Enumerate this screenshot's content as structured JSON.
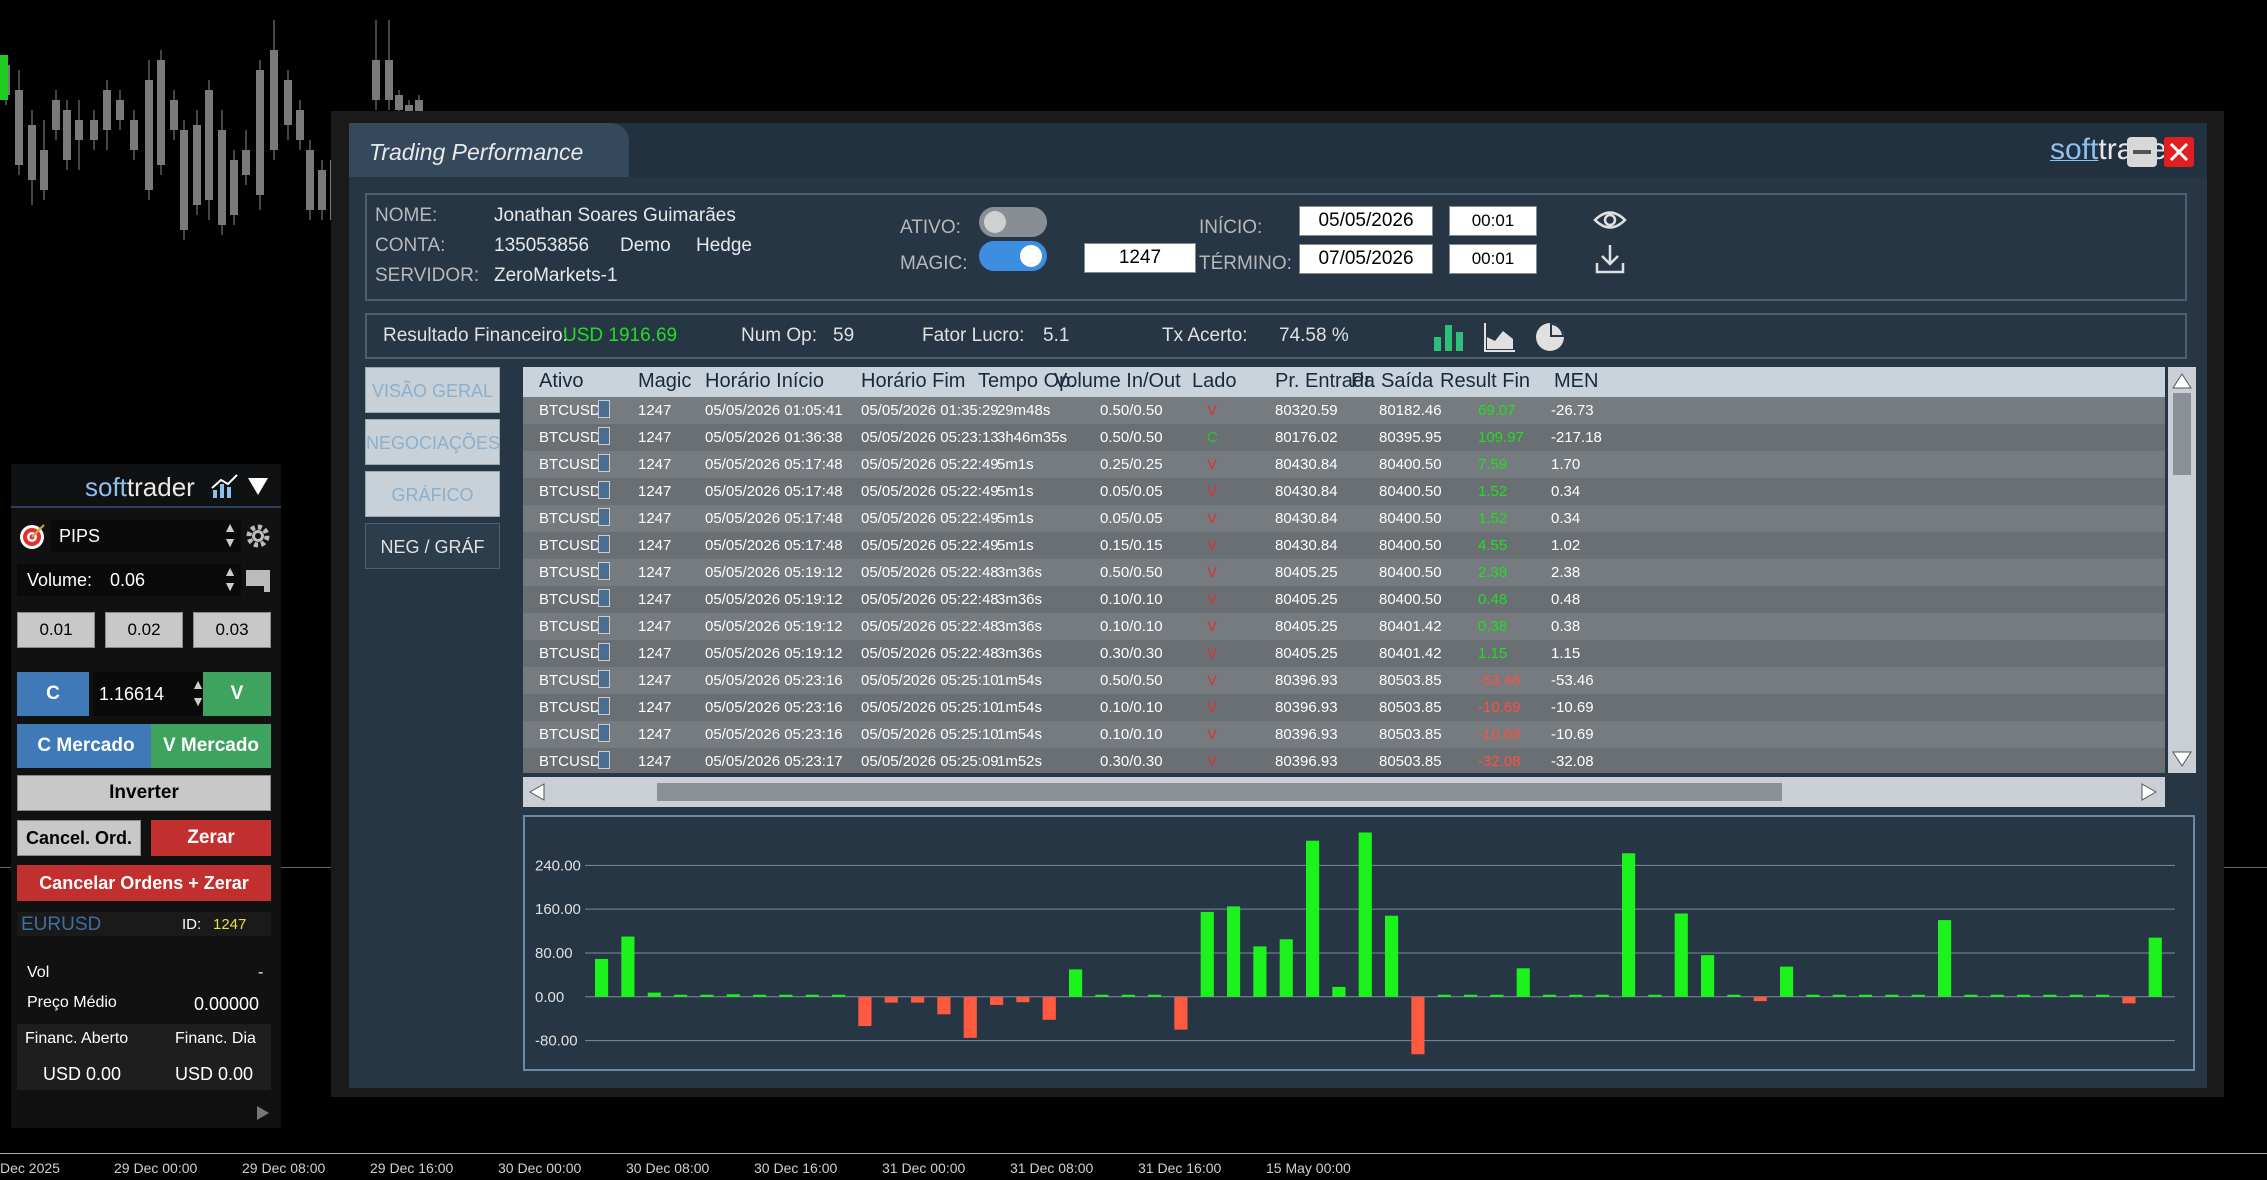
{
  "background": {
    "time_labels": [
      "Dec 2025",
      "29 Dec 00:00",
      "29 Dec 08:00",
      "29 Dec 16:00",
      "30 Dec 00:00",
      "30 Dec 08:00",
      "30 Dec 16:00",
      "31 Dec 00:00",
      "31 Dec 08:00",
      "31 Dec 16:00",
      "15 May 00:00"
    ]
  },
  "left_panel": {
    "brand_soft": "soft",
    "brand_trader": "trader",
    "mode_value": "PIPS",
    "volume_label": "Volume:",
    "volume_value": "0.06",
    "lot_buttons": [
      "0.01",
      "0.02",
      "0.03"
    ],
    "buy_label": "C",
    "price_value": "1.16614",
    "sell_label": "V",
    "buy_market_label": "C Mercado",
    "sell_market_label": "V Mercado",
    "invert_label": "Inverter",
    "cancel_orders_label": "Cancel. Ord.",
    "zero_label": "Zerar",
    "cancel_zero_label": "Cancelar Ordens + Zerar",
    "symbol": "EURUSD",
    "id_label": "ID:",
    "id_value": "1247",
    "vol_label": "Vol",
    "vol_value": "-",
    "avg_price_label": "Preço Médio",
    "avg_price_value": "0.00000",
    "open_fin_label": "Financ. Aberto",
    "day_fin_label": "Financ. Dia",
    "open_fin_value": "USD 0.00",
    "day_fin_value": "USD 0.00"
  },
  "window": {
    "title": "Trading Performance",
    "brand_soft": "soft",
    "brand_trader": "trader"
  },
  "info": {
    "name_label": "NOME:",
    "name_value": "Jonathan Soares Guimarães",
    "account_label": "CONTA:",
    "account_value": "135053856",
    "account_type": "Demo",
    "account_mode": "Hedge",
    "server_label": "SERVIDOR:",
    "server_value": "ZeroMarkets-1",
    "ativo_label": "ATIVO:",
    "magic_label": "MAGIC:",
    "magic_value": "1247",
    "start_label": "INÍCIO:",
    "start_date": "05/05/2026",
    "start_time": "00:01",
    "end_label": "TÉRMINO:",
    "end_date": "07/05/2026",
    "end_time": "00:01"
  },
  "summary": {
    "result_label": "Resultado Financeiro:",
    "result_value": "USD 1916.69",
    "num_op_label": "Num Op:",
    "num_op_value": "59",
    "profit_factor_label": "Fator Lucro:",
    "profit_factor_value": "5.1",
    "hit_rate_label": "Tx Acerto:",
    "hit_rate_value": "74.58 %"
  },
  "side_buttons": [
    "VISÃO GERAL",
    "NEGOCIAÇÕES",
    "GRÁFICO",
    "NEG / GRÁF"
  ],
  "table": {
    "headers": [
      "Ativo",
      "Magic",
      "Horário Início",
      "Horário Fim",
      "Tempo Op.",
      "Volume In/Out",
      "Lado",
      "Pr. Entrada",
      "Pr. Saída",
      "Result Fin",
      "MEN"
    ],
    "rows": [
      [
        "BTCUSD",
        "1247",
        "05/05/2026  01:05:41",
        "05/05/2026  01:35:29",
        "29m48s",
        "0.50/0.50",
        "V",
        "80320.59",
        "80182.46",
        "69.07",
        "-26.73"
      ],
      [
        "BTCUSD",
        "1247",
        "05/05/2026  01:36:38",
        "05/05/2026  05:23:13",
        "3h46m35s",
        "0.50/0.50",
        "C",
        "80176.02",
        "80395.95",
        "109.97",
        "-217.18"
      ],
      [
        "BTCUSD",
        "1247",
        "05/05/2026  05:17:48",
        "05/05/2026  05:22:49",
        "5m1s",
        "0.25/0.25",
        "V",
        "80430.84",
        "80400.50",
        "7.59",
        "1.70"
      ],
      [
        "BTCUSD",
        "1247",
        "05/05/2026  05:17:48",
        "05/05/2026  05:22:49",
        "5m1s",
        "0.05/0.05",
        "V",
        "80430.84",
        "80400.50",
        "1.52",
        "0.34"
      ],
      [
        "BTCUSD",
        "1247",
        "05/05/2026  05:17:48",
        "05/05/2026  05:22:49",
        "5m1s",
        "0.05/0.05",
        "V",
        "80430.84",
        "80400.50",
        "1.52",
        "0.34"
      ],
      [
        "BTCUSD",
        "1247",
        "05/05/2026  05:17:48",
        "05/05/2026  05:22:49",
        "5m1s",
        "0.15/0.15",
        "V",
        "80430.84",
        "80400.50",
        "4.55",
        "1.02"
      ],
      [
        "BTCUSD",
        "1247",
        "05/05/2026  05:19:12",
        "05/05/2026  05:22:48",
        "3m36s",
        "0.50/0.50",
        "V",
        "80405.25",
        "80400.50",
        "2.38",
        "2.38"
      ],
      [
        "BTCUSD",
        "1247",
        "05/05/2026  05:19:12",
        "05/05/2026  05:22:48",
        "3m36s",
        "0.10/0.10",
        "V",
        "80405.25",
        "80400.50",
        "0.48",
        "0.48"
      ],
      [
        "BTCUSD",
        "1247",
        "05/05/2026  05:19:12",
        "05/05/2026  05:22:48",
        "3m36s",
        "0.10/0.10",
        "V",
        "80405.25",
        "80401.42",
        "0.38",
        "0.38"
      ],
      [
        "BTCUSD",
        "1247",
        "05/05/2026  05:19:12",
        "05/05/2026  05:22:48",
        "3m36s",
        "0.30/0.30",
        "V",
        "80405.25",
        "80401.42",
        "1.15",
        "1.15"
      ],
      [
        "BTCUSD",
        "1247",
        "05/05/2026  05:23:16",
        "05/05/2026  05:25:10",
        "1m54s",
        "0.50/0.50",
        "V",
        "80396.93",
        "80503.85",
        "-53.46",
        "-53.46"
      ],
      [
        "BTCUSD",
        "1247",
        "05/05/2026  05:23:16",
        "05/05/2026  05:25:10",
        "1m54s",
        "0.10/0.10",
        "V",
        "80396.93",
        "80503.85",
        "-10.69",
        "-10.69"
      ],
      [
        "BTCUSD",
        "1247",
        "05/05/2026  05:23:16",
        "05/05/2026  05:25:10",
        "1m54s",
        "0.10/0.10",
        "V",
        "80396.93",
        "80503.85",
        "-10.69",
        "-10.69"
      ],
      [
        "BTCUSD",
        "1247",
        "05/05/2026  05:23:17",
        "05/05/2026  05:25:09",
        "1m52s",
        "0.30/0.30",
        "V",
        "80396.93",
        "80503.85",
        "-32.08",
        "-32.08"
      ]
    ]
  },
  "colors": {
    "positive": "#22dd22",
    "negative": "#ff5040",
    "side_sell": "#e03030",
    "side_buy": "#22cc22",
    "accent": "#3f79b7"
  },
  "chart_data": {
    "type": "bar",
    "yticks": [
      "240.00",
      "160.00",
      "80.00",
      "0.00",
      "-80.00"
    ],
    "ylim": [
      -110,
      310
    ],
    "values": [
      69.07,
      109.97,
      7.59,
      1.52,
      1.52,
      4.55,
      2.38,
      0.48,
      0.38,
      1.15,
      -53.46,
      -10.69,
      -10.69,
      -32.08,
      -75,
      -15,
      -10,
      -42,
      50,
      1,
      2,
      1,
      -60,
      155,
      165,
      92,
      105,
      285,
      18,
      300,
      148,
      -105,
      3,
      2,
      2,
      52,
      2,
      2,
      2,
      262,
      2,
      152,
      76,
      3,
      -8,
      55,
      2,
      2,
      2,
      2,
      2,
      140,
      2,
      2,
      2,
      2,
      2,
      2,
      -12,
      108
    ]
  }
}
